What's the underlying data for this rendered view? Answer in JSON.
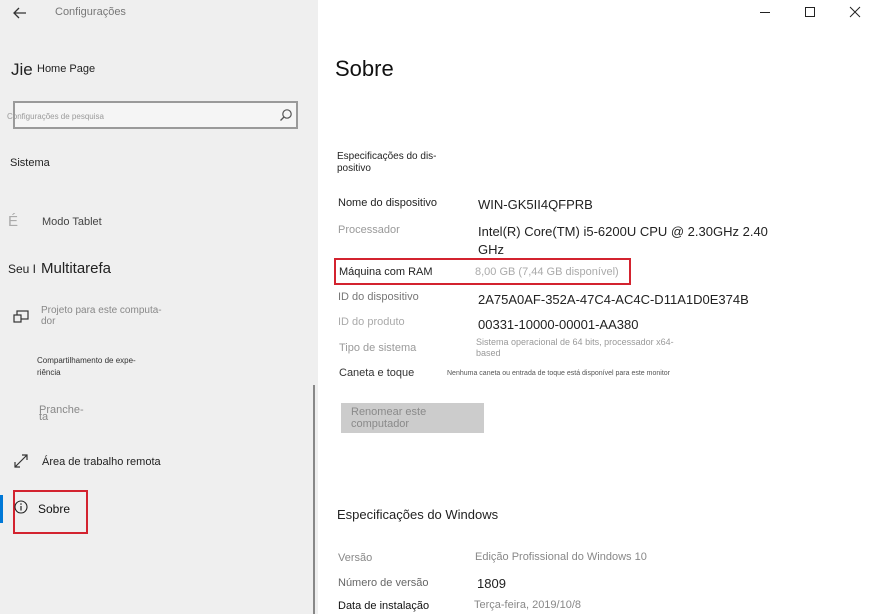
{
  "header": {
    "back_icon": "arrow-left-icon",
    "title": "Configurações"
  },
  "left": {
    "home_prefix": "Jie",
    "home_label": "Home Page",
    "search_placeholder": "Configurações de pesquisa",
    "search_icon": "search-icon",
    "section": "Sistema",
    "items": [
      {
        "prefix": "É",
        "label": "Modo Tablet"
      },
      {
        "prefix": "Seu I",
        "label": "Multitarefa"
      },
      {
        "label_line1": "Projeto para este computa-",
        "label_line2": "dor",
        "icon": "projector-icon"
      },
      {
        "label_line1": "Compartilhamento de expe-",
        "label_line2": "riência"
      },
      {
        "label_line1": "Pranche-",
        "label_line2": "ta"
      },
      {
        "label": "Área de trabalho remota",
        "icon": "remote-desktop-icon"
      },
      {
        "label": "Sobre",
        "icon": "info-icon"
      }
    ]
  },
  "window_controls": {
    "minimize": "minimize-icon",
    "maximize": "maximize-icon",
    "close": "close-icon"
  },
  "main": {
    "title": "Sobre",
    "device_specs_title_line1": "Especificações do dis-",
    "device_specs_title_line2": "positivo",
    "specs": [
      {
        "label": "Nome do dispositivo",
        "value": "WIN-GK5II4QFPRB"
      },
      {
        "label": "Processador",
        "value_line1": "Intel(R) Core(TM) i5-6200U CPU @ 2.30GHz   2.40",
        "value_line2": "GHz"
      },
      {
        "label": "Máquina com RAM",
        "value": "8,00 GB (7,44 GB disponível)"
      },
      {
        "label": "ID do dispositivo",
        "value": "2A75A0AF-352A-47C4-AC4C-D11A1D0E374B"
      },
      {
        "label": "ID do produto",
        "value": "00331-10000-00001-AA380"
      },
      {
        "label": "Tipo de sistema",
        "value_line1": "Sistema operacional de 64 bits, processador x64-",
        "value_line2": "based"
      },
      {
        "label": "Caneta e toque",
        "value": "Nenhuma caneta ou entrada de toque está disponível para este monitor"
      }
    ],
    "rename_button": "Renomear este computador",
    "windows_specs_title": "Especificações do Windows",
    "windows_specs": [
      {
        "label": "Versão",
        "value": "Edição Profissional do Windows 10"
      },
      {
        "label": "Número de versão",
        "value": "1809"
      },
      {
        "label": "Data de instalação",
        "value": "Terça-feira, 2019/10/8"
      }
    ]
  },
  "colors": {
    "highlight_border": "#d3232f",
    "accent": "#0078d7",
    "left_bg": "#efefef"
  }
}
